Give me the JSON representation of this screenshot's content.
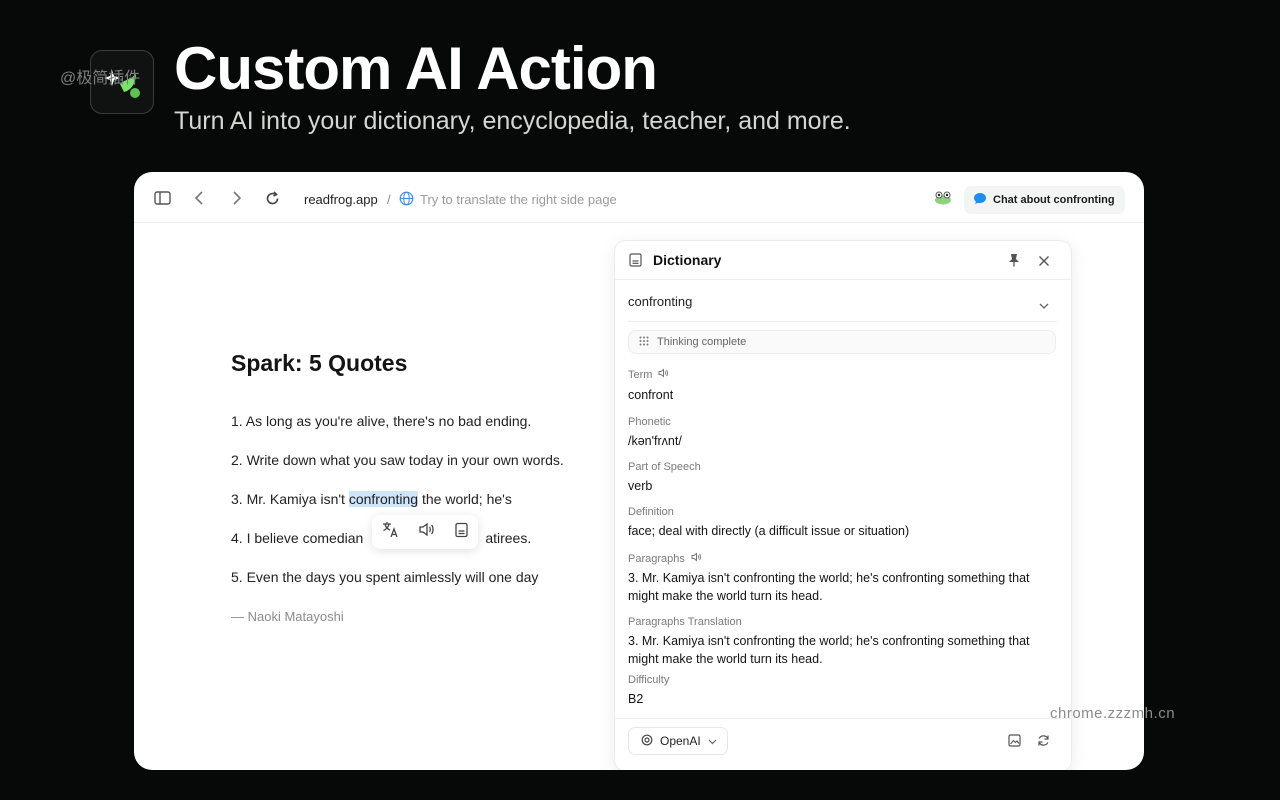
{
  "hero": {
    "title": "Custom AI Action",
    "subtitle": "Turn AI into your dictionary, encyclopedia, teacher, and more.",
    "watermark": "@极简插件"
  },
  "browser": {
    "url_host": "readfrog.app",
    "url_separator": "/",
    "url_placeholder": "Try to translate the right side page",
    "chat_button": "Chat about confronting"
  },
  "page": {
    "title": "Spark: 5 Quotes",
    "quotes": [
      "1. As long as you're alive, there's no bad ending.",
      "2. Write down what you saw today in your own words.",
      "3. Mr. Kamiya isn't",
      "confronting",
      "the world; he's",
      "4. I believe comedian",
      "atirees.",
      "5. Even the days you spent aimlessly will one day"
    ],
    "author": "— Naoki Matayoshi"
  },
  "dictionary": {
    "title": "Dictionary",
    "selected_term": "confronting",
    "thinking": "Thinking complete",
    "fields": [
      {
        "label": "Term",
        "value": "confront"
      },
      {
        "label": "Phonetic",
        "value": "/kən'frʌnt/"
      },
      {
        "label": "Part of Speech",
        "value": "verb"
      },
      {
        "label": "Definition",
        "value": "face; deal with directly (a difficult issue or situation)"
      },
      {
        "label": "Paragraphs",
        "value": "3. Mr. Kamiya isn't confronting the world; he's confronting something that might make the world turn its head."
      },
      {
        "label": "Paragraphs Translation",
        "value": "3. Mr. Kamiya isn't confronting the world; he's confronting something that might make the world turn its head."
      },
      {
        "label": "Difficulty",
        "value": "B2"
      }
    ],
    "model": "OpenAI"
  },
  "footer_watermark": "chrome.zzzmh.cn",
  "colors": {
    "accent": "#1f8ef1",
    "highlight": "#cfe5fb",
    "brand_green": "#7be36a"
  }
}
